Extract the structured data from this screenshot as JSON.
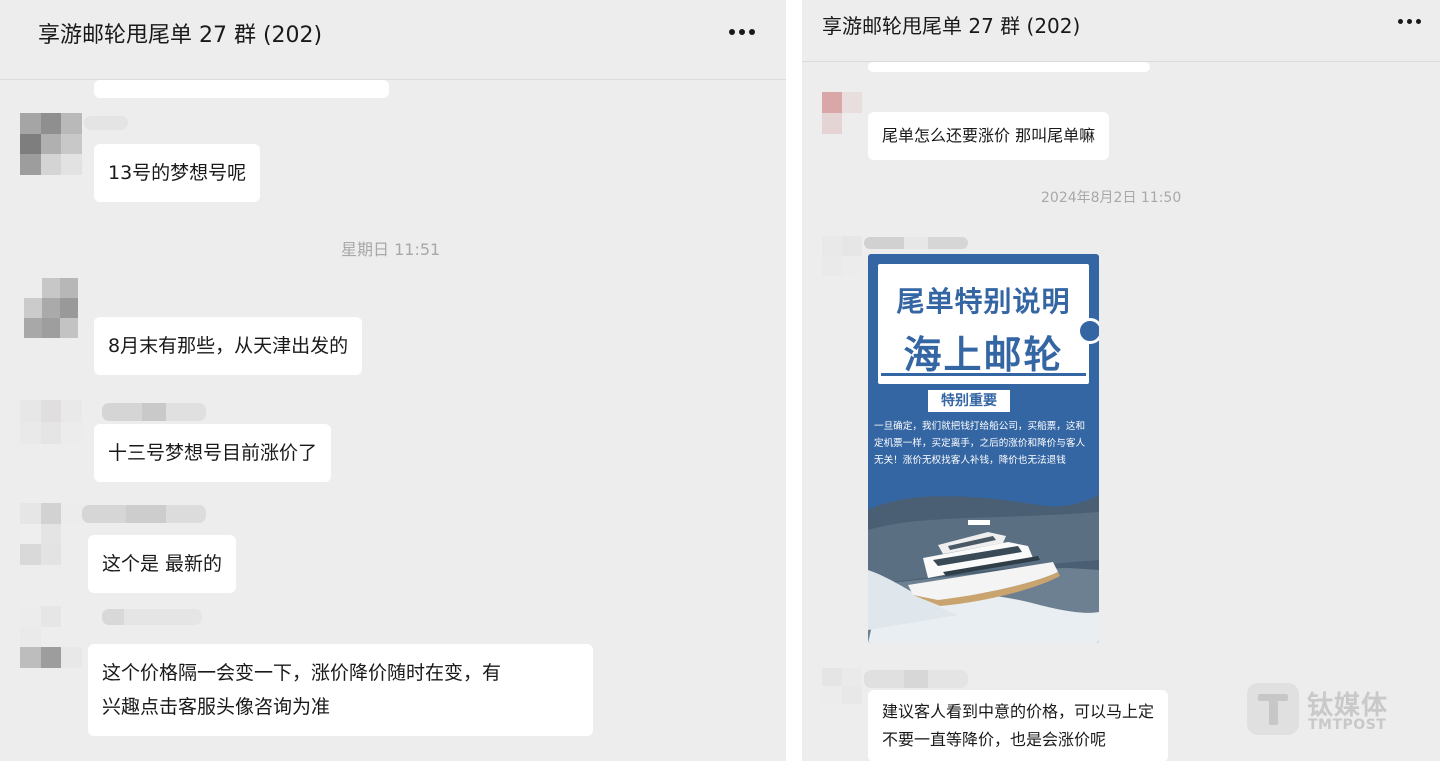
{
  "left_chat": {
    "title": "享游邮轮甩尾单 27 群 (202)",
    "timestamp": "星期日 11:51",
    "messages": [
      "13号的梦想号呢",
      "8月末有那些，从天津出发的",
      "十三号梦想号目前涨价了",
      "这个是 最新的",
      "这个价格隔一会变一下，涨价降价随时在变，有",
      "兴趣点击客服头像咨询为准"
    ]
  },
  "right_chat": {
    "title": "享游邮轮甩尾单 27 群 (202)",
    "timestamp": "2024年8月2日 11:50",
    "messages": [
      "尾单怎么还要涨价 那叫尾单嘛",
      "建议客人看到中意的价格，可以马上定",
      "不要一直等降价，也是会涨价呢"
    ],
    "poster": {
      "title_line1": "尾单特别说明",
      "title_line2": "海上邮轮",
      "badge": "特别重要",
      "body": "一旦确定，我们就把钱打给船公司，买船票，这和定机票一样，买定离手，之后的涨价和降价与客人无关！涨价无权找客人补钱，降价也无法退钱"
    }
  },
  "watermark": {
    "name_cn": "钛媒体",
    "name_en": "TMTPOST"
  },
  "colors": {
    "chat_background": "#ededed",
    "bubble": "#ffffff",
    "poster_blue": "#3566a4",
    "timestamp": "#a8a8a8"
  }
}
